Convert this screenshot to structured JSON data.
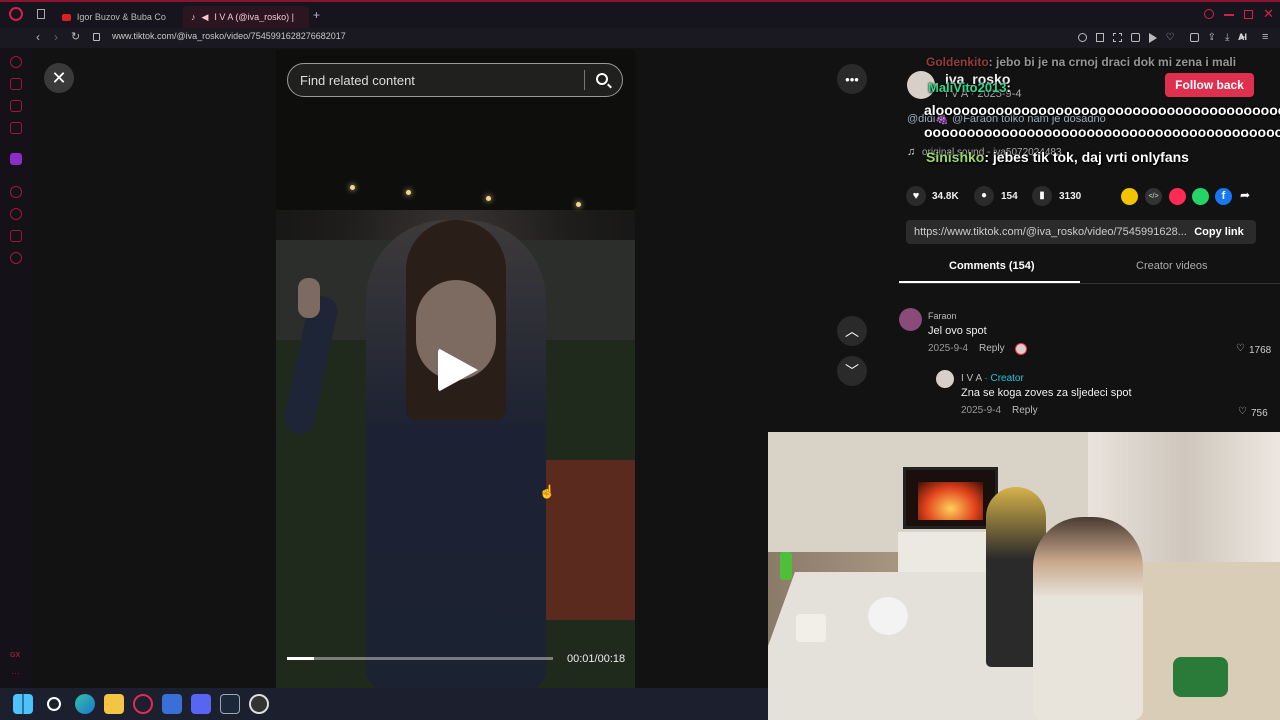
{
  "browser": {
    "tabs": [
      {
        "label": "Igor Buzov & Buba Coreli"
      },
      {
        "label": "I V A (@iva_rosko) |"
      }
    ],
    "url": "www.tiktok.com/@iva_rosko/video/7545991628276682017",
    "ai_label": "AI"
  },
  "video": {
    "search_placeholder": "Find related content",
    "time": "00:01/00:18",
    "progress": 0.1
  },
  "profile": {
    "username": "iva_rosko",
    "meta": "I V A · 2025-9-4",
    "follow_label": "Follow back",
    "mention_line": "@didi🍇 @Faraon tolko nam je dosadno",
    "sound_label": "original sound - iva5072024483"
  },
  "chat_overlay": [
    {
      "user": "Goldenkito",
      "text": ": jebo bi je na crnoj draci dok mi zena i mali",
      "user_color": "#ff5f5f"
    },
    {
      "user": "MaliVito2013",
      "text": ":",
      "user_color": "#34d98c"
    },
    {
      "user": "",
      "text": "alooooooooooooooooooooooooooooooooooooooooooooooooooooooooooo",
      "user_color": "#ffffff"
    },
    {
      "user": "",
      "text": "oooooooooooooooooooooooooooooooooooooooooooooooooooooooooooooo",
      "user_color": "#ffffff"
    },
    {
      "user": "Sinishko",
      "text": ": jebes tik tok, daj vrti onlyfans",
      "user_color": "#9bd86a"
    }
  ],
  "actions": {
    "likes": "34.8K",
    "comments": "154",
    "saves": "3130"
  },
  "share": {
    "url_text": "https://www.tiktok.com/@iva_rosko/video/7545991628...",
    "copy_label": "Copy link"
  },
  "tabs": {
    "comments_label": "Comments (154)",
    "creator_label": "Creator videos"
  },
  "comments": [
    {
      "user": "Faraon",
      "text": "Jel ovo spot",
      "date": "2025-9-4",
      "reply": "Reply",
      "likes": "1768"
    },
    {
      "user": "I V A",
      "creator_tag": "· Creator",
      "text": "Zna se koga zoves za sljedeci spot",
      "date": "2025-9-4",
      "reply": "Reply",
      "likes": "756"
    }
  ],
  "colors": {
    "accent": "#e0304f",
    "creator": "#25c2d6"
  },
  "sidebar_bottom": "GX"
}
